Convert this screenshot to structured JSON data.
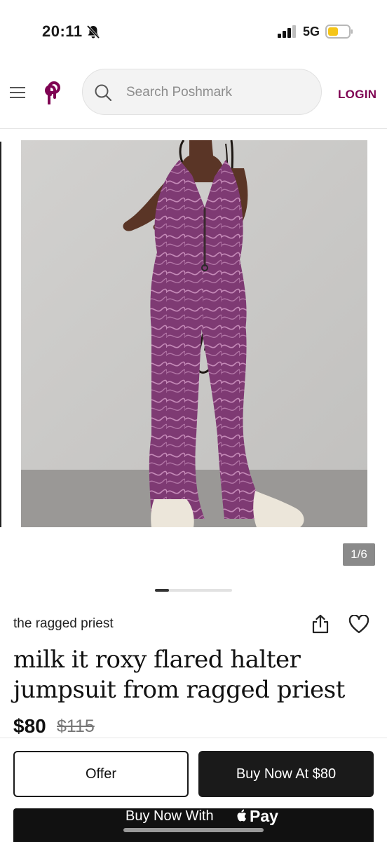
{
  "status": {
    "time": "20:11",
    "network": "5G"
  },
  "header": {
    "search_placeholder": "Search Poshmark",
    "login_label": "LOGIN"
  },
  "listing": {
    "image_counter": "1/6",
    "brand": "the ragged priest",
    "title": "milk it roxy flared halter jumpsuit from ragged priest",
    "price": "$80",
    "original_price": "$115"
  },
  "actions": {
    "offer_label": "Offer",
    "buy_now_label": "Buy Now At $80",
    "apple_pay_prefix": "Buy Now With",
    "apple_pay_suffix": "Pay"
  },
  "colors": {
    "brand": "#7f0353",
    "jumpsuit": "#7e3a73",
    "dark_button": "#1a1a1a"
  },
  "icons": [
    "bell-slash-icon",
    "signal-icon",
    "battery-icon",
    "menu-icon",
    "poshmark-logo-icon",
    "search-icon",
    "share-icon",
    "heart-icon",
    "apple-logo-icon"
  ]
}
